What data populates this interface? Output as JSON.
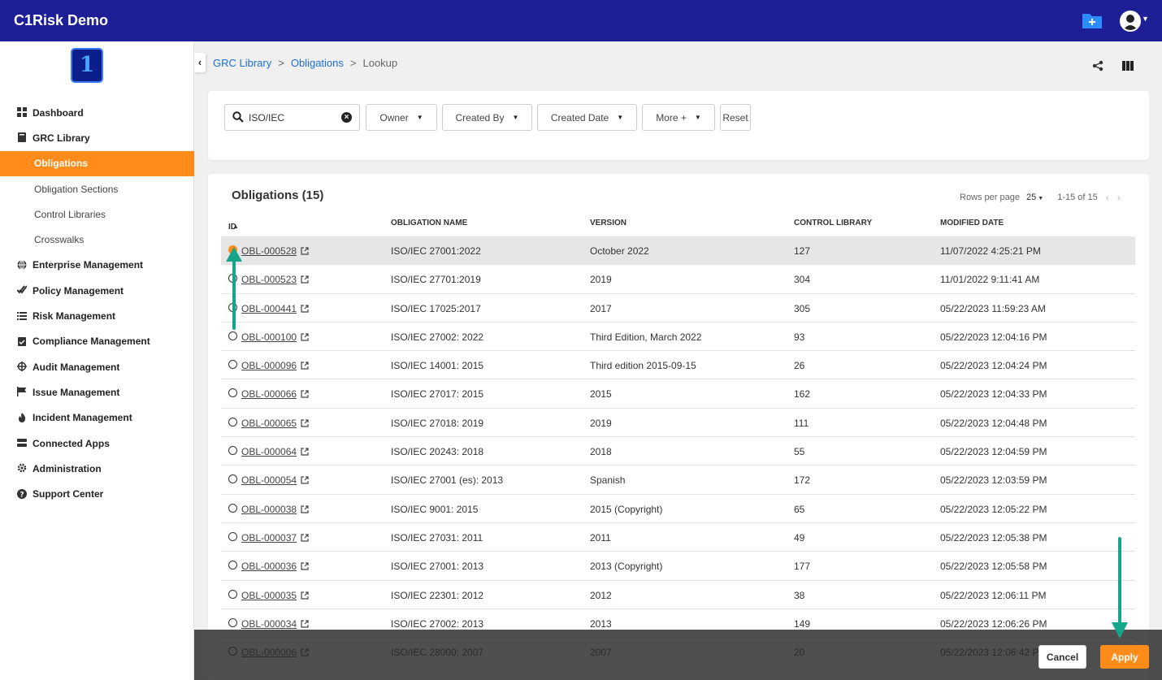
{
  "app": {
    "title": "C1Risk Demo"
  },
  "header": {
    "folder_icon": "folder-add-icon",
    "avatar_icon": "user-avatar-icon"
  },
  "sidebar": {
    "logo_text": "1",
    "items": [
      {
        "label": "Dashboard",
        "icon": "grid-icon",
        "level": "top"
      },
      {
        "label": "GRC Library",
        "icon": "book-icon",
        "level": "top"
      },
      {
        "label": "Obligations",
        "level": "sub",
        "active": true
      },
      {
        "label": "Obligation Sections",
        "level": "sub"
      },
      {
        "label": "Control Libraries",
        "level": "sub"
      },
      {
        "label": "Crosswalks",
        "level": "sub"
      },
      {
        "label": "Enterprise Management",
        "icon": "globe-icon",
        "level": "top"
      },
      {
        "label": "Policy Management",
        "icon": "check-double-icon",
        "level": "top"
      },
      {
        "label": "Risk Management",
        "icon": "list-icon",
        "level": "top"
      },
      {
        "label": "Compliance Management",
        "icon": "clipboard-check-icon",
        "level": "top"
      },
      {
        "label": "Audit Management",
        "icon": "crosshair-icon",
        "level": "top"
      },
      {
        "label": "Issue Management",
        "icon": "flag-icon",
        "level": "top"
      },
      {
        "label": "Incident Management",
        "icon": "fire-icon",
        "level": "top"
      },
      {
        "label": "Connected Apps",
        "icon": "server-icon",
        "level": "top"
      },
      {
        "label": "Administration",
        "icon": "gear-icon",
        "level": "top"
      },
      {
        "label": "Support Center",
        "icon": "question-circle-icon",
        "level": "top"
      }
    ]
  },
  "breadcrumb": {
    "items": [
      "GRC Library",
      "Obligations",
      "Lookup"
    ],
    "separator": ">"
  },
  "filters": {
    "search_value": "ISO/IEC",
    "dropdowns": [
      "Owner",
      "Created By",
      "Created Date",
      "More +"
    ],
    "reset_label": "Reset"
  },
  "table": {
    "title": "Obligations (15)",
    "rows_per_page_label": "Rows per page",
    "rows_per_page_value": "25",
    "range_label": "1-15 of 15",
    "columns": [
      "ID",
      "OBLIGATION NAME",
      "VERSION",
      "CONTROL LIBRARY",
      "MODIFIED DATE"
    ],
    "rows": [
      {
        "id": "OBL-000528",
        "name": "ISO/IEC 27001:2022",
        "version": "October 2022",
        "control_library": "127",
        "modified": "11/07/2022 4:25:21 PM",
        "selected": true
      },
      {
        "id": "OBL-000523",
        "name": "ISO/IEC 27701:2019",
        "version": "2019",
        "control_library": "304",
        "modified": "11/01/2022 9:11:41 AM"
      },
      {
        "id": "OBL-000441",
        "name": "ISO/IEC 17025:2017",
        "version": "2017",
        "control_library": "305",
        "modified": "05/22/2023 11:59:23 AM"
      },
      {
        "id": "OBL-000100",
        "name": "ISO/IEC 27002: 2022",
        "version": "Third Edition, March 2022",
        "control_library": "93",
        "modified": "05/22/2023 12:04:16 PM"
      },
      {
        "id": "OBL-000096",
        "name": "ISO/IEC 14001: 2015",
        "version": "Third edition 2015-09-15",
        "control_library": "26",
        "modified": "05/22/2023 12:04:24 PM"
      },
      {
        "id": "OBL-000066",
        "name": "ISO/IEC 27017: 2015",
        "version": "2015",
        "control_library": "162",
        "modified": "05/22/2023 12:04:33 PM"
      },
      {
        "id": "OBL-000065",
        "name": "ISO/IEC 27018: 2019",
        "version": "2019",
        "control_library": "111",
        "modified": "05/22/2023 12:04:48 PM"
      },
      {
        "id": "OBL-000064",
        "name": "ISO/IEC 20243: 2018",
        "version": "2018",
        "control_library": "55",
        "modified": "05/22/2023 12:04:59 PM"
      },
      {
        "id": "OBL-000054",
        "name": "ISO/IEC 27001 (es): 2013",
        "version": "Spanish",
        "control_library": "172",
        "modified": "05/22/2023 12:03:59 PM"
      },
      {
        "id": "OBL-000038",
        "name": "ISO/IEC 9001: 2015",
        "version": "2015 (Copyright)",
        "control_library": "65",
        "modified": "05/22/2023 12:05:22 PM"
      },
      {
        "id": "OBL-000037",
        "name": "ISO/IEC 27031: 2011",
        "version": "2011",
        "control_library": "49",
        "modified": "05/22/2023 12:05:38 PM"
      },
      {
        "id": "OBL-000036",
        "name": "ISO/IEC 27001: 2013",
        "version": "2013 (Copyright)",
        "control_library": "177",
        "modified": "05/22/2023 12:05:58 PM"
      },
      {
        "id": "OBL-000035",
        "name": "ISO/IEC 22301: 2012",
        "version": "2012",
        "control_library": "38",
        "modified": "05/22/2023 12:06:11 PM"
      },
      {
        "id": "OBL-000034",
        "name": "ISO/IEC 27002: 2013",
        "version": "2013",
        "control_library": "149",
        "modified": "05/22/2023 12:06:26 PM"
      },
      {
        "id": "OBL-000006",
        "name": "ISO/IEC 28000: 2007",
        "version": "2007",
        "control_library": "20",
        "modified": "05/22/2023 12:06:42 PM"
      }
    ]
  },
  "footer": {
    "cancel_label": "Cancel",
    "apply_label": "Apply"
  },
  "colors": {
    "header_bg": "#1e1e96",
    "accent": "#ff8c1a",
    "link": "#1e6fd6",
    "annotation_arrow": "#17a589"
  }
}
